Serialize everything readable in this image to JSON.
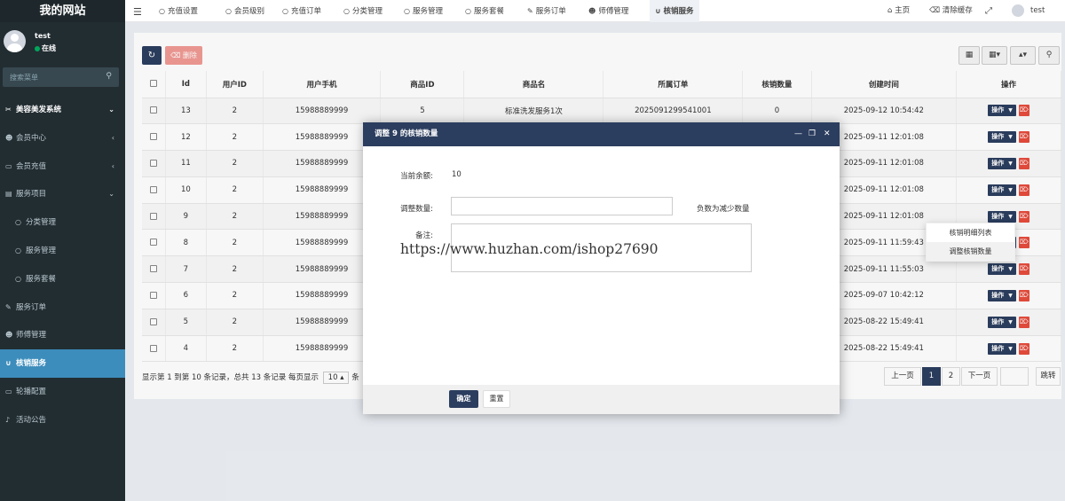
{
  "sidebar": {
    "brand": "我的网站",
    "user_name": "test",
    "user_status": "在线",
    "search_placeholder": "搜索菜单",
    "items": [
      {
        "label": "美容美发系统",
        "icon": "✂",
        "type": "header",
        "arrow": "⌄"
      },
      {
        "label": "会员中心",
        "icon": "☻",
        "type": "item",
        "arrow": "‹"
      },
      {
        "label": "会员充值",
        "icon": "▭",
        "type": "item",
        "arrow": "‹"
      },
      {
        "label": "服务项目",
        "icon": "▤",
        "type": "item",
        "arrow": "⌄"
      },
      {
        "label": "分类管理",
        "icon": "○",
        "type": "sub"
      },
      {
        "label": "服务管理",
        "icon": "○",
        "type": "sub"
      },
      {
        "label": "服务套餐",
        "icon": "○",
        "type": "sub"
      },
      {
        "label": "服务订单",
        "icon": "✎",
        "type": "item"
      },
      {
        "label": "师傅管理",
        "icon": "☻",
        "type": "item"
      },
      {
        "label": "核销服务",
        "icon": "∪",
        "type": "active"
      },
      {
        "label": "轮播配置",
        "icon": "▭",
        "type": "item"
      },
      {
        "label": "活动公告",
        "icon": "♪",
        "type": "item"
      }
    ]
  },
  "topnav": {
    "tabs": [
      {
        "label": "充值设置",
        "icon": "○"
      },
      {
        "label": "会员级别",
        "icon": "○"
      },
      {
        "label": "充值订单",
        "icon": "○"
      },
      {
        "label": "分类管理",
        "icon": "○"
      },
      {
        "label": "服务管理",
        "icon": "○"
      },
      {
        "label": "服务套餐",
        "icon": "○"
      },
      {
        "label": "服务订单",
        "icon": "✎"
      },
      {
        "label": "师傅管理",
        "icon": "☻"
      },
      {
        "label": "核销服务",
        "icon": "∪"
      }
    ],
    "home": "主页",
    "clear_cache": "清除缓存",
    "user": "test"
  },
  "toolbar": {
    "delete_label": "删除"
  },
  "table": {
    "headers": [
      "Id",
      "用户ID",
      "用户手机",
      "商品ID",
      "商品名",
      "所属订单",
      "核销数量",
      "创建时间",
      "操作"
    ],
    "action_label": "操作",
    "rows": [
      {
        "id": "13",
        "uid": "2",
        "phone": "15988889999",
        "gid": "5",
        "gname": "标准洗发服务1次",
        "order": "2025091299541001",
        "qty": "0",
        "time": "2025-09-12 10:54:42"
      },
      {
        "id": "12",
        "uid": "2",
        "phone": "15988889999",
        "gid": "",
        "gname": "",
        "order": "",
        "qty": "",
        "time": "2025-09-11 12:01:08"
      },
      {
        "id": "11",
        "uid": "2",
        "phone": "15988889999",
        "gid": "",
        "gname": "",
        "order": "",
        "qty": "",
        "time": "2025-09-11 12:01:08"
      },
      {
        "id": "10",
        "uid": "2",
        "phone": "15988889999",
        "gid": "",
        "gname": "",
        "order": "",
        "qty": "",
        "time": "2025-09-11 12:01:08"
      },
      {
        "id": "9",
        "uid": "2",
        "phone": "15988889999",
        "gid": "",
        "gname": "",
        "order": "",
        "qty": "",
        "time": "2025-09-11 12:01:08"
      },
      {
        "id": "8",
        "uid": "2",
        "phone": "15988889999",
        "gid": "",
        "gname": "",
        "order": "",
        "qty": "",
        "time": "2025-09-11 11:59:43"
      },
      {
        "id": "7",
        "uid": "2",
        "phone": "15988889999",
        "gid": "",
        "gname": "",
        "order": "",
        "qty": "",
        "time": "2025-09-11 11:55:03"
      },
      {
        "id": "6",
        "uid": "2",
        "phone": "15988889999",
        "gid": "",
        "gname": "",
        "order": "",
        "qty": "",
        "time": "2025-09-07 10:42:12"
      },
      {
        "id": "5",
        "uid": "2",
        "phone": "15988889999",
        "gid": "",
        "gname": "",
        "order": "",
        "qty": "",
        "time": "2025-08-22 15:49:41"
      },
      {
        "id": "4",
        "uid": "2",
        "phone": "15988889999",
        "gid": "",
        "gname": "",
        "order": "",
        "qty": "",
        "time": "2025-08-22 15:49:41"
      }
    ]
  },
  "pagination": {
    "info": "显示第 1 到第 10 条记录，总共 13 条记录 每页显示",
    "page_size": "10",
    "suffix": "条",
    "prev": "上一页",
    "pages": [
      "1",
      "2"
    ],
    "next": "下一页",
    "jump": "跳转"
  },
  "dialog": {
    "title": "调整 9 的核销数量",
    "balance_label": "当前余额:",
    "balance_value": "10",
    "qty_label": "调整数量:",
    "qty_value": "",
    "qty_hint": "负数为减少数量",
    "remark_label": "备注:",
    "remark_value": "",
    "ok": "确定",
    "reset": "重置",
    "watermark": "https://www.huzhan.com/ishop27690"
  },
  "dropdown": {
    "items": [
      "核销明细列表",
      "调整核销数量"
    ]
  },
  "colors": {
    "sidebar_bg": "#222d32",
    "primary": "#2c3e5f",
    "active": "#3c8dbc",
    "danger": "#e74c3c"
  }
}
